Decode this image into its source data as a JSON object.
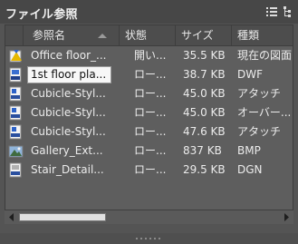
{
  "panel": {
    "title": "ファイル参照"
  },
  "columns": {
    "name": "参照名",
    "status": "状態",
    "size": "サイズ",
    "type": "種類"
  },
  "rows": [
    {
      "icon": "dwg-current-drawing-icon",
      "name": "Office floor_...",
      "status": "開い...",
      "size": "35.5 KB",
      "type": "現在の図面"
    },
    {
      "icon": "dwf-file-icon",
      "name": "1st floor pla...",
      "status": "ロー...",
      "size": "38.7 KB",
      "type": "DWF"
    },
    {
      "icon": "dwg-xref-icon",
      "name": "Cubicle-Styl...",
      "status": "ロー...",
      "size": "45.0 KB",
      "type": "アタッチ"
    },
    {
      "icon": "dwg-xref-icon",
      "name": "Cubicle-Styl...",
      "status": "ロー...",
      "size": "45.0 KB",
      "type": "オーバー..."
    },
    {
      "icon": "dwg-xref-icon",
      "name": "Cubicle-Styl...",
      "status": "ロー...",
      "size": "47.6 KB",
      "type": "アタッチ"
    },
    {
      "icon": "image-file-icon",
      "name": "Gallery_Ext...",
      "status": "ロー...",
      "size": "837 KB",
      "type": "BMP"
    },
    {
      "icon": "dgn-file-icon",
      "name": "Stair_Detail...",
      "status": "ロー...",
      "size": "29.5 KB",
      "type": "DGN"
    }
  ],
  "selected_row": 1
}
